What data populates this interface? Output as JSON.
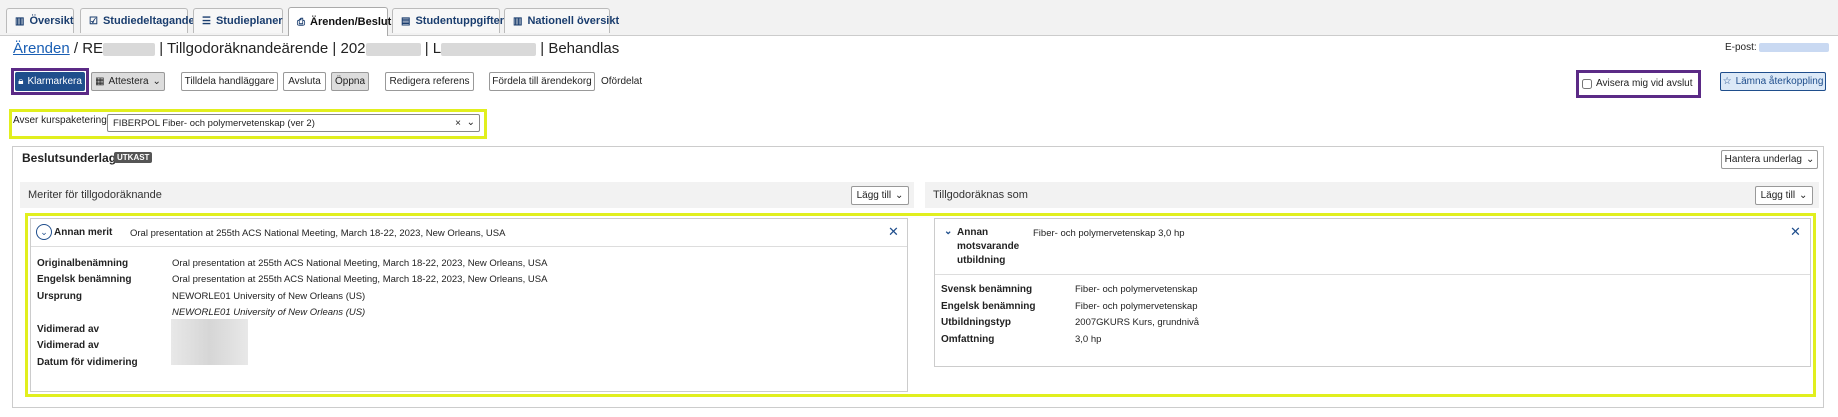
{
  "tabs": [
    {
      "label": "Översikt",
      "icon": "map-icon"
    },
    {
      "label": "Studiedeltagande",
      "icon": "checkbox-icon"
    },
    {
      "label": "Studieplaner",
      "icon": "list-icon"
    },
    {
      "label": "Ärenden/Beslut",
      "icon": "inbox-icon",
      "active": true
    },
    {
      "label": "Studentuppgifter",
      "icon": "document-icon"
    },
    {
      "label": "Nationell översikt",
      "icon": "map-icon"
    }
  ],
  "header": {
    "breadcrumb_link": "Ärenden",
    "sep1": " / RE",
    "part2": "| Tillgodoräknandeärende | 202",
    "part3": "| L",
    "status": "| Behandlas",
    "email_label": "E-post:"
  },
  "toolbar": {
    "klarmarkera": "Klarmarkera",
    "attestera": "Attestera",
    "tilldela": "Tilldela handläggare",
    "avsluta": "Avsluta",
    "oppna": "Öppna",
    "redigera": "Redigera referens",
    "fordela": "Fördela till ärendekorg",
    "ofordelat": "Ofördelat",
    "avisera": "Avisera mig vid avslut",
    "lamna": "Lämna återkoppling"
  },
  "course": {
    "label": "Avser kurspaketering",
    "value": "FIBERPOL Fiber- och polymervetenskap (ver 2)"
  },
  "beslut": {
    "title": "Beslutsunderlag",
    "badge": "UTKAST",
    "hantera": "Hantera underlag"
  },
  "left": {
    "heading": "Meriter för tillgodoräknande",
    "add": "Lägg till",
    "type": "Annan merit",
    "summary": "Oral presentation at 255th ACS National Meeting, March 18-22, 2023, New Orleans, USA",
    "rows": [
      {
        "label": "Originalbenämning",
        "value": "Oral presentation at 255th ACS National Meeting, March 18-22, 2023, New Orleans, USA"
      },
      {
        "label": "Engelsk benämning",
        "value": "Oral presentation at 255th ACS National Meeting, March 18-22, 2023, New Orleans, USA"
      },
      {
        "label": "Ursprung",
        "value": "NEWORLE01 University of New Orleans (US)"
      }
    ],
    "origin_italic": "NEWORLE01 University of New Orleans (US)",
    "vid1": "Vidimerad av",
    "vid2": "Vidimerad av",
    "vid_date": "Datum för vidimering"
  },
  "right": {
    "heading": "Tillgodoräknas som",
    "add": "Lägg till",
    "type1": "Annan",
    "type2": "motsvarande",
    "type3": "utbildning",
    "summary": "Fiber- och polymervetenskap 3,0 hp",
    "rows": [
      {
        "label": "Svensk benämning",
        "value": "Fiber- och polymervetenskap"
      },
      {
        "label": "Engelsk benämning",
        "value": "Fiber- och polymervetenskap"
      },
      {
        "label": "Utbildningstyp",
        "value": "2007GKURS Kurs, grundnivå"
      },
      {
        "label": "Omfattning",
        "value": "3,0 hp"
      }
    ]
  },
  "colors": {
    "accent": "#1f4e8c",
    "highlight_yellow": "#e1ef1e",
    "highlight_purple": "#5b2a86"
  }
}
